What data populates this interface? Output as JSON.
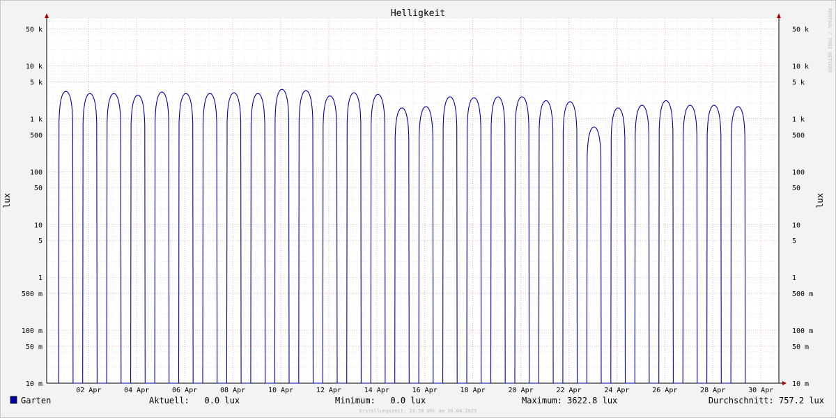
{
  "chart_data": {
    "type": "line",
    "title": "Helligkeit",
    "ylabel": "lux",
    "y_scale": "log",
    "ylim": [
      0.01,
      80000
    ],
    "y_ticks": [
      {
        "value": 50000,
        "label": "50 k"
      },
      {
        "value": 10000,
        "label": "10 k"
      },
      {
        "value": 5000,
        "label": "5 k"
      },
      {
        "value": 1000,
        "label": "1 k"
      },
      {
        "value": 500,
        "label": "500"
      },
      {
        "value": 100,
        "label": "100"
      },
      {
        "value": 50,
        "label": "50"
      },
      {
        "value": 10,
        "label": "10"
      },
      {
        "value": 5,
        "label": "5"
      },
      {
        "value": 1,
        "label": "1"
      },
      {
        "value": 0.5,
        "label": "500 m"
      },
      {
        "value": 0.1,
        "label": "100 m"
      },
      {
        "value": 0.05,
        "label": "50 m"
      },
      {
        "value": 0.01,
        "label": "10 m"
      }
    ],
    "x_axis": {
      "unit": "day of April 2025",
      "range": [
        0.25,
        30.75
      ],
      "ticks": [
        {
          "value": 2,
          "label": "02 Apr"
        },
        {
          "value": 4,
          "label": "04 Apr"
        },
        {
          "value": 6,
          "label": "06 Apr"
        },
        {
          "value": 8,
          "label": "08 Apr"
        },
        {
          "value": 10,
          "label": "10 Apr"
        },
        {
          "value": 12,
          "label": "12 Apr"
        },
        {
          "value": 14,
          "label": "14 Apr"
        },
        {
          "value": 16,
          "label": "16 Apr"
        },
        {
          "value": 18,
          "label": "18 Apr"
        },
        {
          "value": 20,
          "label": "20 Apr"
        },
        {
          "value": 22,
          "label": "22 Apr"
        },
        {
          "value": 24,
          "label": "24 Apr"
        },
        {
          "value": 26,
          "label": "26 Apr"
        },
        {
          "value": 28,
          "label": "28 Apr"
        },
        {
          "value": 30,
          "label": "30 Apr"
        }
      ]
    },
    "series": [
      {
        "name": "Garten",
        "color": "#0000aa",
        "daily_peak_lux": [
          3300,
          3000,
          3000,
          2800,
          3200,
          3000,
          3000,
          3100,
          3000,
          3600,
          3400,
          2700,
          3100,
          2900,
          1600,
          1700,
          2600,
          2500,
          2600,
          2600,
          2200,
          2100,
          700,
          1600,
          1800,
          2200,
          1800,
          1800,
          1700
        ]
      }
    ],
    "grid": true,
    "legend_position": "bottom-left"
  },
  "legend": {
    "label": "Garten",
    "color": "#0000aa"
  },
  "stats": {
    "aktuell": "Aktuell:   0.0 lux",
    "minimum": "Minimum:   0.0 lux",
    "maximum": "Maximum: 3622.8 lux",
    "durchschnitt": "Durchschnitt: 757.2 lux"
  },
  "watermark": "RRDTOOL / TOBI OETIKER",
  "footer": "Erstellungszeit: 23:58 Uhr am 30.04.2025"
}
